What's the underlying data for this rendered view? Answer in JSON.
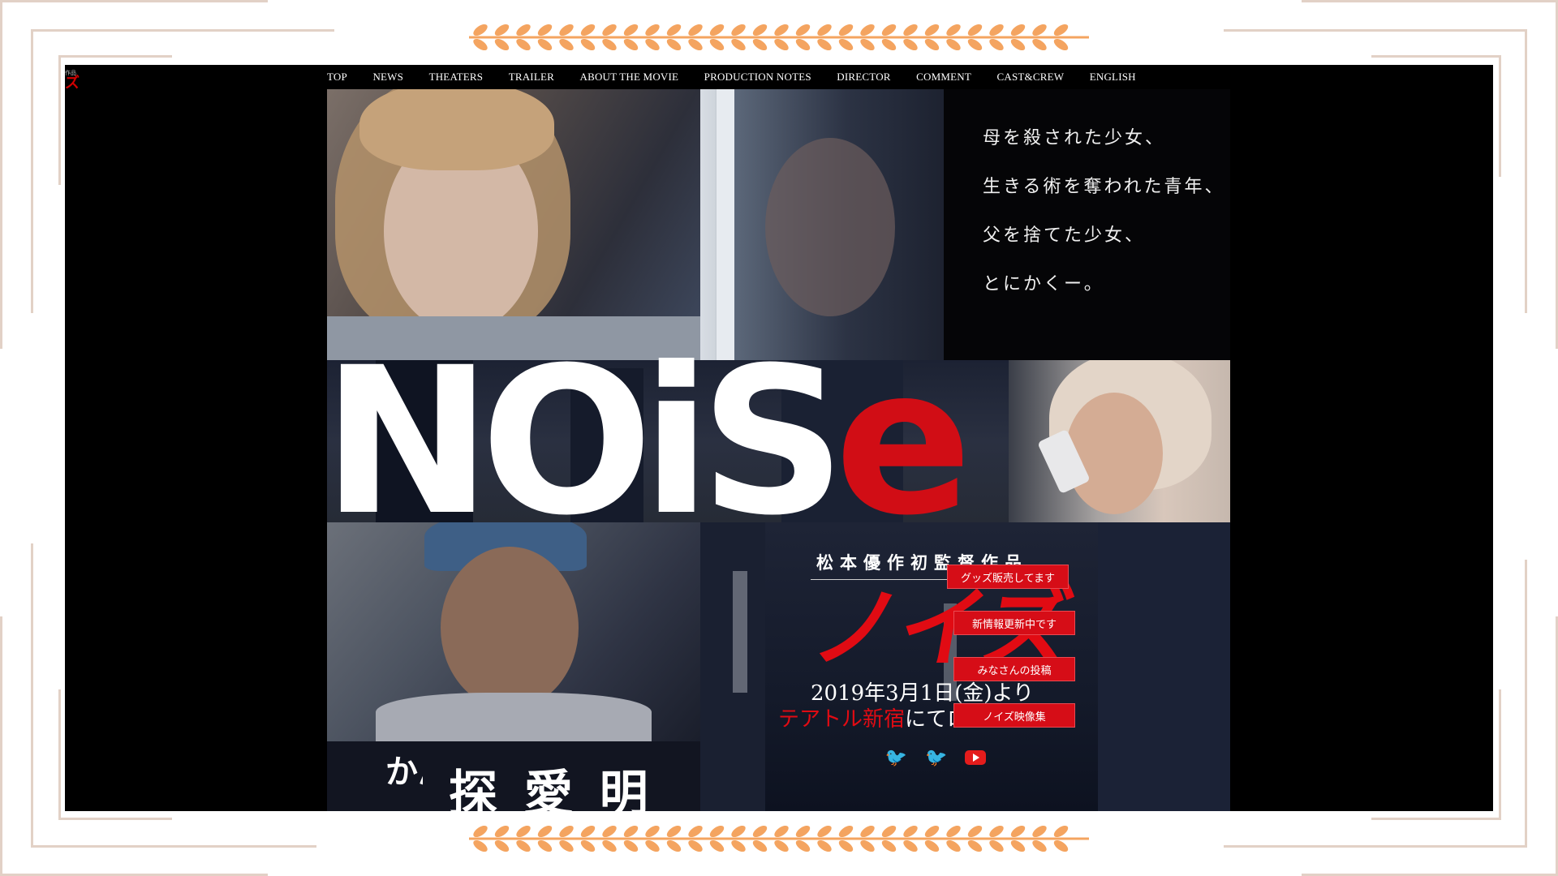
{
  "nav": {
    "items": [
      "TOP",
      "NEWS",
      "THEATERS",
      "TRAILER",
      "ABOUT THE MOVIE",
      "PRODUCTION NOTES",
      "DIRECTOR",
      "COMMENT",
      "CAST&CREW",
      "ENGLISH"
    ]
  },
  "mini_logo": {
    "top_text": "作品",
    "kana": "ズ"
  },
  "poem": {
    "lines": [
      "母を殺された少女、",
      "生きる術を奪われた青年、",
      "父を捨てた少女、",
      "とにかくー。"
    ]
  },
  "title": {
    "main": "NOiS",
    "accent": "e"
  },
  "director_line": "松本優作初監督作品",
  "jp_title": "ノイズ",
  "release": {
    "date": "2019年3月1日(金)より",
    "theater": "テアトル新宿",
    "suffix": "にてロードショー"
  },
  "buttons": [
    "グッズ販売してます",
    "新情報更新中です",
    "みなさんの投稿",
    "ノイズ映像集"
  ],
  "social": {
    "icons": [
      "twitter-icon",
      "twitter-icon",
      "youtube-icon"
    ]
  },
  "bottom_text": {
    "small": "かん",
    "big": "探 愛 明"
  },
  "colors": {
    "accent_red": "#d10d15",
    "twitter_blue": "#1d9bf0",
    "frame": "#e2d1c6",
    "vine": "#f4a460"
  }
}
